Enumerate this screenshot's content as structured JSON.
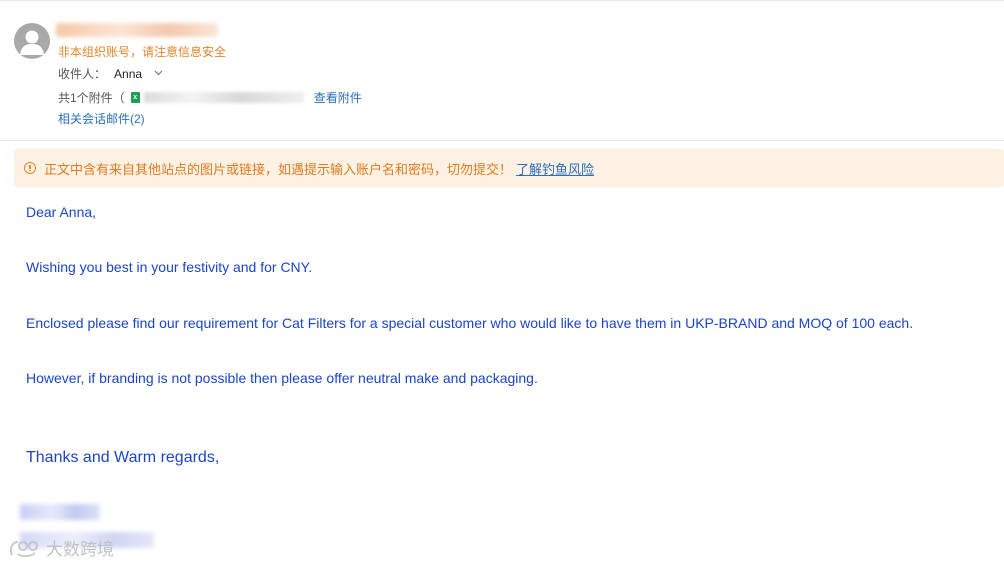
{
  "header": {
    "account_warning": "非本组织账号，请注意信息安全",
    "recipient_label": "收件人：",
    "recipient_name": "Anna",
    "attachment_prefix": "共1个附件（",
    "view_attachment": "查看附件",
    "related_mails": "相关会话邮件(2)"
  },
  "banner": {
    "text": "正文中含有来自其他站点的图片或链接，如遇提示输入账户名和密码，切勿提交！",
    "link": "了解钓鱼风险"
  },
  "body": {
    "greeting": "Dear Anna,",
    "line1": "Wishing you best in your festivity and for CNY.",
    "line2": "Enclosed please find our requirement for Cat Filters for a special customer who would like to have them in UKP-BRAND and MOQ of 100 each.",
    "line3": "However, if branding is not possible then please offer neutral make and packaging.",
    "closing": "Thanks and Warm regards,"
  },
  "watermark": {
    "text": "大数跨境"
  },
  "colors": {
    "body_text": "#1b44c8",
    "warning": "#e3862c",
    "link": "#2a6fb8",
    "banner_bg": "#fdf1e3"
  }
}
